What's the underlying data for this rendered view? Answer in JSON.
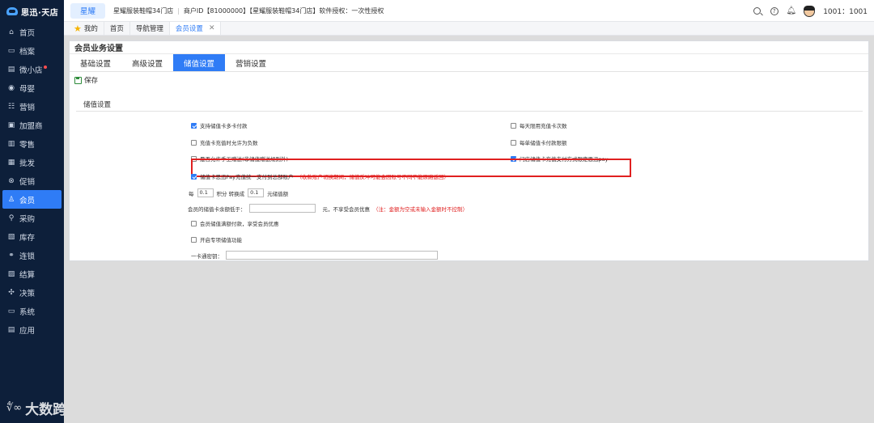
{
  "app": {
    "logo_text": "思迅·天店"
  },
  "sidebar": {
    "items": [
      {
        "label": "首页",
        "icon": "home-icon",
        "glyph": "⌂"
      },
      {
        "label": "档案",
        "icon": "folder-icon",
        "glyph": "▭"
      },
      {
        "label": "微小店",
        "icon": "shop-icon",
        "glyph": "▤",
        "badge": true
      },
      {
        "label": "母婴",
        "icon": "baby-icon",
        "glyph": "◉"
      },
      {
        "label": "营销",
        "icon": "marketing-icon",
        "glyph": "☷"
      },
      {
        "label": "加盟商",
        "icon": "franchise-icon",
        "glyph": "▣"
      },
      {
        "label": "零售",
        "icon": "retail-icon",
        "glyph": "▥"
      },
      {
        "label": "批发",
        "icon": "wholesale-icon",
        "glyph": "▦"
      },
      {
        "label": "促销",
        "icon": "promotion-icon",
        "glyph": "⊗"
      },
      {
        "label": "会员",
        "icon": "member-icon",
        "glyph": "♙",
        "active": true
      },
      {
        "label": "采购",
        "icon": "purchase-icon",
        "glyph": "⚲"
      },
      {
        "label": "库存",
        "icon": "inventory-icon",
        "glyph": "▧"
      },
      {
        "label": "连锁",
        "icon": "chain-icon",
        "glyph": "⚭"
      },
      {
        "label": "结算",
        "icon": "settlement-icon",
        "glyph": "▨"
      },
      {
        "label": "决策",
        "icon": "decision-icon",
        "glyph": "✣"
      },
      {
        "label": "系统",
        "icon": "system-icon",
        "glyph": "▭"
      },
      {
        "label": "应用",
        "icon": "apps-icon",
        "glyph": "▤"
      }
    ]
  },
  "watermark": {
    "mark": "∜∞",
    "text": "大数跨境"
  },
  "topbar": {
    "brand_tab": "星耀",
    "store_name": "星耀服装鞋帽34门店",
    "account": "商户ID【81000000】【星耀服装鞋帽34门店】软件授权：一次性授权",
    "user": "1001：1001"
  },
  "tabs": {
    "favorites": "我的",
    "items": [
      "首页",
      "导航管理"
    ],
    "active": "会员设置"
  },
  "panel": {
    "title": "会员业务设置",
    "subtabs": [
      "基础设置",
      "高级设置",
      "储值设置",
      "营销设置"
    ],
    "active_subtab_index": 2,
    "save_label": "保存",
    "section_title": "储值设置"
  },
  "options": {
    "multi_card_pay": {
      "label": "支持储值卡多卡付款",
      "checked": true
    },
    "daily_limit": {
      "label": "每天限用充值卡次数",
      "checked": false
    },
    "allow_negative": {
      "label": "充值卡充值时允许为负数",
      "checked": false
    },
    "single_limit": {
      "label": "每单储值卡付款限额",
      "checked": false
    },
    "manual_gift": {
      "label": "是否允许手工赠送(非储值赠送规则外)",
      "checked": false
    },
    "store_pay_limit": {
      "label": "门店储值卡充值支付方式限定思迅pay",
      "checked": true
    },
    "unified_account": {
      "label": "储值卡思迅Pay充值统一支付到总部账户",
      "note": "（收款账户切换期间，储值反冲可能会因账号不同不能原路返回）",
      "checked": true
    },
    "points_prefix": "每",
    "points_value": "0.1",
    "points_mid": "积分  转换成",
    "points_amount": "0.1",
    "points_suffix": "元储值额",
    "balance_label": "会员的储值卡余额低于：",
    "balance_value": "",
    "balance_suffix": "元，不享受会员优惠",
    "balance_note": "（注：金额为空或未输入金额时不控制）",
    "full_pay_discount": {
      "label": "会员储值满额付款，享受会员优惠",
      "checked": false
    },
    "dedicated_stored_value": {
      "label": "开启专项储值功能",
      "checked": false
    },
    "card_secret_label": "一卡通密钥：",
    "card_secret_value": ""
  }
}
